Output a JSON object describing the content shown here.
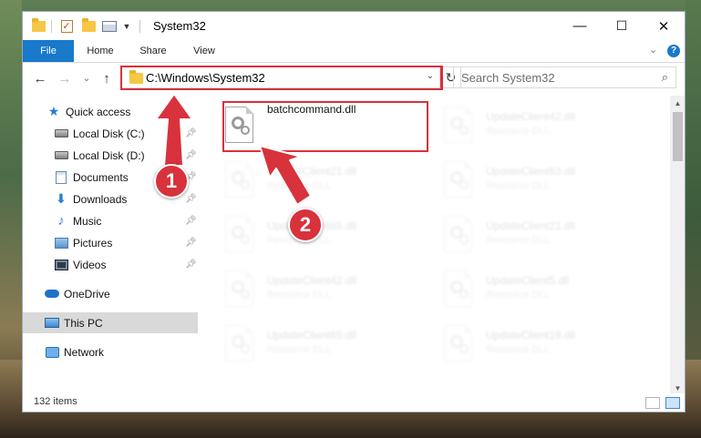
{
  "window": {
    "title": "System32",
    "controls": {
      "minimize": "—",
      "maximize": "☐",
      "close": "✕"
    }
  },
  "ribbon": {
    "tabs": [
      "File",
      "Home",
      "Share",
      "View"
    ],
    "expand_glyph": "⌄",
    "help_glyph": "?"
  },
  "nav": {
    "back": "←",
    "forward": "→",
    "recent": "⌄",
    "up": "↑",
    "address": "C:\\Windows\\System32",
    "address_drop": "⌄",
    "refresh": "↻",
    "search_placeholder": "Search System32",
    "search_glyph": "⌕"
  },
  "sidebar": {
    "items": [
      {
        "label": "Quick access",
        "icon": "star-icon"
      },
      {
        "label": "Local Disk (C:)",
        "icon": "drive-icon",
        "pinned": true
      },
      {
        "label": "Local Disk (D:)",
        "icon": "drive-icon",
        "pinned": true
      },
      {
        "label": "Documents",
        "icon": "documents-icon",
        "pinned": true
      },
      {
        "label": "Downloads",
        "icon": "download-icon",
        "pinned": true
      },
      {
        "label": "Music",
        "icon": "music-icon",
        "pinned": true
      },
      {
        "label": "Pictures",
        "icon": "pictures-icon",
        "pinned": true
      },
      {
        "label": "Videos",
        "icon": "videos-icon",
        "pinned": true
      },
      {
        "label": "OneDrive",
        "icon": "onedrive-icon"
      },
      {
        "label": "This PC",
        "icon": "this-pc-icon",
        "selected": true
      },
      {
        "label": "Network",
        "icon": "network-icon"
      }
    ]
  },
  "files": [
    {
      "name": "batchcommand.dll",
      "type": "",
      "highlighted": true
    },
    {
      "name": "UpdateClient42.dll",
      "type": "Resource DLL"
    },
    {
      "name": "UpdateClient21.dll",
      "type": "Resource DLL"
    },
    {
      "name": "UpdateClient63.dll",
      "type": "Resource DLL"
    },
    {
      "name": "UpdateClient65.dll",
      "type": "Resource DLL"
    },
    {
      "name": "UpdateClient21.dll",
      "type": "Resource DLL"
    },
    {
      "name": "UpdateClient42.dll",
      "type": "Resource DLL"
    },
    {
      "name": "UpdateClient5.dll",
      "type": "Resource DLL"
    },
    {
      "name": "UpdateClient65.dll",
      "type": "Resource DLL"
    },
    {
      "name": "UpdateClient19.dll",
      "type": "Resource DLL"
    }
  ],
  "status": {
    "items": "132 items"
  },
  "annotations": {
    "step1": "1",
    "step2": "2"
  },
  "colors": {
    "accent": "#1979ca",
    "annotation": "#d8323c",
    "selected_bg": "#d9d9d9"
  }
}
